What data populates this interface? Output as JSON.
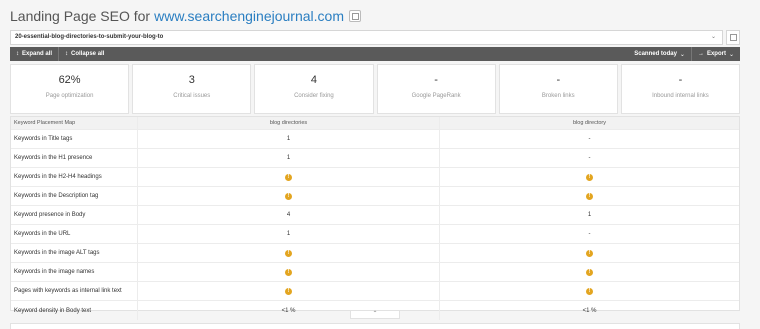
{
  "header": {
    "title": "Landing Page SEO for",
    "domain": "www.searchenginejournal.com"
  },
  "url_selector": {
    "value": "20-essential-blog-directories-to-submit-your-blog-to",
    "caret": "⌄"
  },
  "toolbar": {
    "expand_label": "Expand all",
    "collapse_label": "Collapse all",
    "scanned_label": "Scanned today",
    "export_label": "Export"
  },
  "stats": [
    {
      "value": "62%",
      "label": "Page optimization"
    },
    {
      "value": "3",
      "label": "Critical issues"
    },
    {
      "value": "4",
      "label": "Consider fixing"
    },
    {
      "value": "-",
      "label": "Google PageRank"
    },
    {
      "value": "-",
      "label": "Broken links"
    },
    {
      "value": "-",
      "label": "Inbound internal links"
    }
  ],
  "table": {
    "headers": [
      "Keyword Placement Map",
      "blog directories",
      "blog directory"
    ],
    "rows": [
      {
        "label": "Keywords in Title tags",
        "a": "1",
        "b": "-"
      },
      {
        "label": "Keywords in the H1 presence",
        "a": "1",
        "b": "-"
      },
      {
        "label": "Keywords in the H2-H4 headings",
        "a": "!",
        "b": "!"
      },
      {
        "label": "Keywords in the Description tag",
        "a": "!",
        "b": "!"
      },
      {
        "label": "Keyword presence in Body",
        "a": "4",
        "b": "1"
      },
      {
        "label": "Keywords in the URL",
        "a": "1",
        "b": "-"
      },
      {
        "label": "Keywords in the image ALT tags",
        "a": "!",
        "b": "!"
      },
      {
        "label": "Keywords in the image names",
        "a": "!",
        "b": "!"
      },
      {
        "label": "Pages with keywords as internal link text",
        "a": "!",
        "b": "!"
      },
      {
        "label": "Keyword density in Body text",
        "a": "<1 %",
        "b": "<1 %"
      }
    ]
  },
  "colors": {
    "link": "#2a7ec1",
    "toolbar": "#5a5a5a",
    "warning": "#e3a520"
  }
}
